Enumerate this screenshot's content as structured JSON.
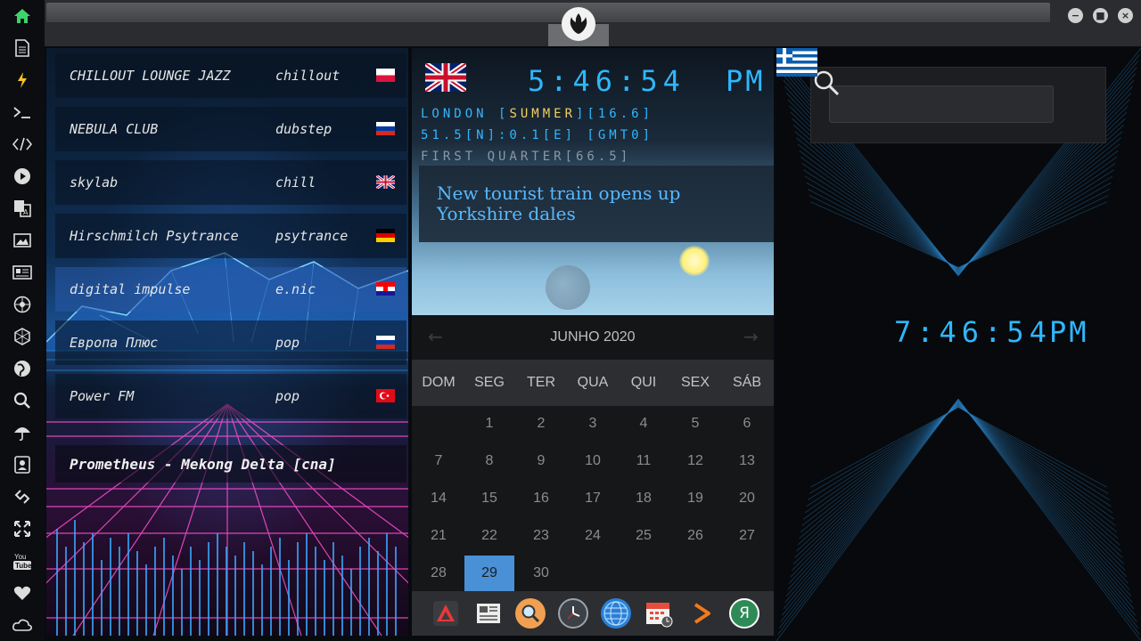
{
  "topbar": {
    "minimize_label": "−",
    "maximize_label": "■",
    "close_label": "×"
  },
  "sidebar": {
    "icons": [
      "home-icon",
      "document-icon",
      "bolt-icon",
      "terminal-icon",
      "code-icon",
      "play-icon",
      "translate-icon",
      "image-icon",
      "news-icon",
      "rebel-alliance-icon",
      "hexagon-icon",
      "globe-icon",
      "search-icon",
      "umbrella-icon",
      "contacts-icon",
      "link-icon",
      "expand-icon",
      "youtube-icon",
      "heart-icon",
      "cloud-icon"
    ]
  },
  "radio": {
    "stations": [
      {
        "name": "CHILLOUT LOUNGE JAZZ",
        "genre": "chillout",
        "flag": "poland-flag"
      },
      {
        "name": "NEBULA CLUB",
        "genre": "dubstep",
        "flag": "russia-flag"
      },
      {
        "name": "skylab",
        "genre": "chill",
        "flag": "uk-flag"
      },
      {
        "name": "Hirschmilch Psytrance",
        "genre": "psytrance",
        "flag": "germany-flag"
      },
      {
        "name": "digital impulse",
        "genre": "e.nic",
        "flag": "croatia-flag"
      },
      {
        "name": "Европа Плюс",
        "genre": "pop",
        "flag": "russia-flag"
      },
      {
        "name": "Power FM",
        "genre": "pop",
        "flag": "turkey-flag"
      }
    ],
    "now_playing": "Prometheus - Mekong Delta [cna]"
  },
  "clock_london": {
    "time": "5:46:54",
    "ampm": "PM",
    "location_prefix": "LONDON [",
    "season": "SUMMER",
    "location_suffix": "][16.6]",
    "coords": "51.5[N]:0.1[E] [GMT0]",
    "moon": "FIRST QUARTER[66.5]",
    "news": "New tourist train opens up Yorkshire dales"
  },
  "calendar": {
    "title": "JUNHO 2020",
    "prev": "←",
    "next": "→",
    "weekdays": [
      "DOM",
      "SEG",
      "TER",
      "QUA",
      "QUI",
      "SEX",
      "SÁB"
    ],
    "days": [
      "1",
      "2",
      "3",
      "4",
      "5",
      "6",
      "7",
      "8",
      "9",
      "10",
      "11",
      "12",
      "13",
      "14",
      "15",
      "16",
      "17",
      "18",
      "19",
      "20",
      "21",
      "22",
      "23",
      "24",
      "25",
      "26",
      "27",
      "28",
      "29",
      "30"
    ],
    "first_weekday_index": 1,
    "selected_day": "29"
  },
  "dock": {
    "items": [
      "anydesk-icon",
      "newspaper-icon",
      "search-icon",
      "clock-icon",
      "globe-icon",
      "calendar-icon",
      "arrow-icon",
      "yandex-icon"
    ],
    "yandex_letter": "Я"
  },
  "right": {
    "search_placeholder": "",
    "clock_athens": {
      "time": "7:46:54",
      "ampm": "PM"
    }
  },
  "colors": {
    "accent_cyan": "#2fb7ff",
    "season_gold": "#f0d060",
    "moon_gray": "#8a98a6",
    "today_blue": "#4a90d6"
  }
}
